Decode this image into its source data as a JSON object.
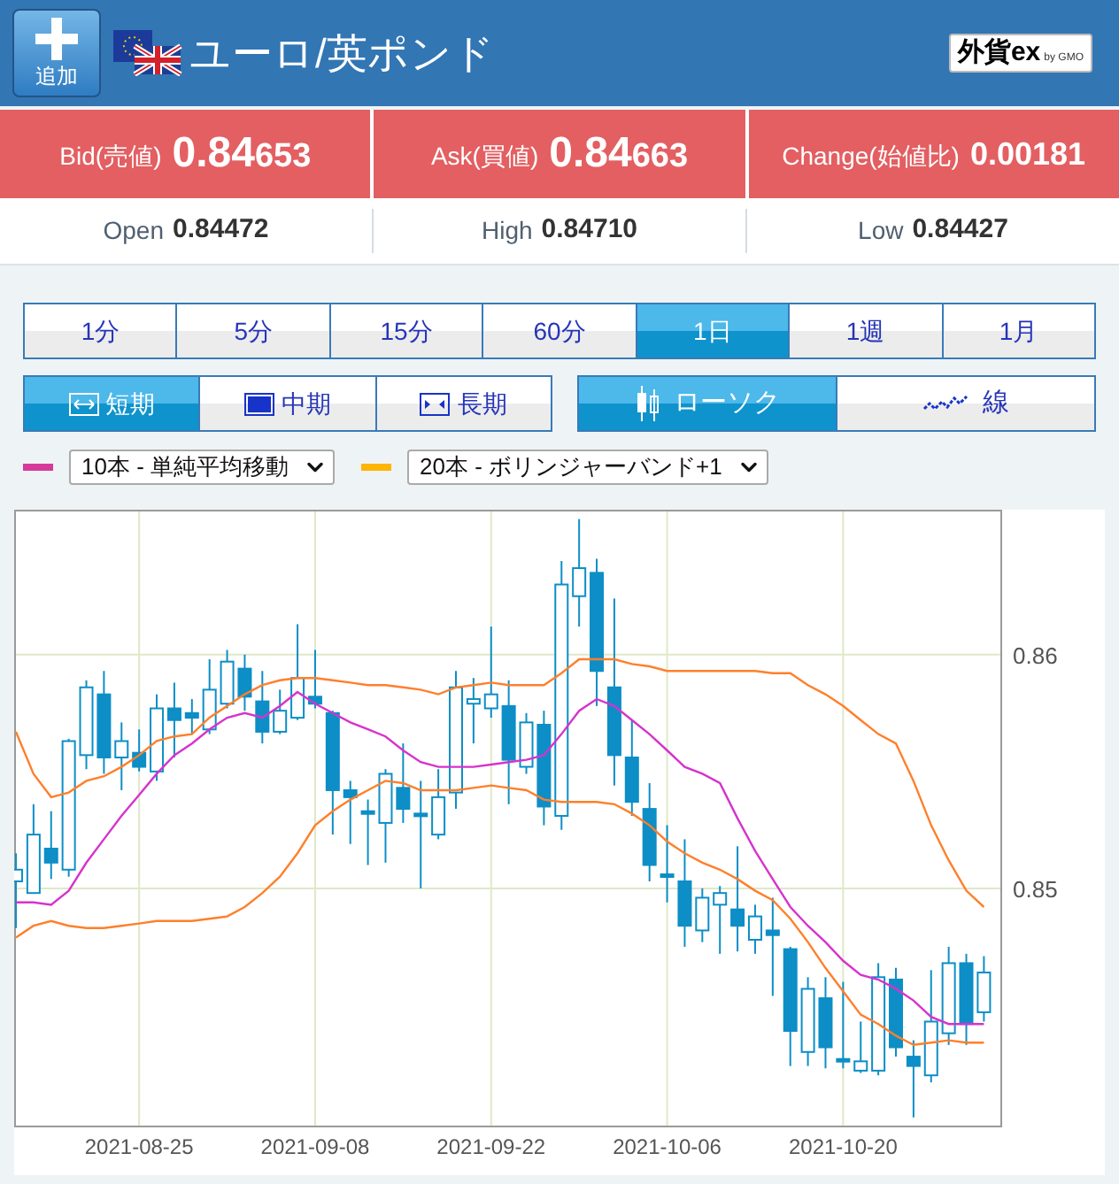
{
  "header": {
    "add_button": "追加",
    "pair": "ユーロ/英ポンド",
    "logo": {
      "mark": "外貨ex",
      "by": "by GMO"
    }
  },
  "quotes": [
    {
      "kind": "split",
      "label": "Bid(売値)",
      "major": "0.84",
      "minor": "653"
    },
    {
      "kind": "split",
      "label": "Ask(買値)",
      "major": "0.84",
      "minor": "663"
    },
    {
      "kind": "plain",
      "label": "Change(始値比)",
      "value": "0.00181"
    }
  ],
  "stats": [
    {
      "label": "Open",
      "value": "0.84472"
    },
    {
      "label": "High",
      "value": "0.84710"
    },
    {
      "label": "Low",
      "value": "0.84427"
    }
  ],
  "timeframes": [
    {
      "label": "1分",
      "selected": false
    },
    {
      "label": "5分",
      "selected": false
    },
    {
      "label": "15分",
      "selected": false
    },
    {
      "label": "60分",
      "selected": false
    },
    {
      "label": "1日",
      "selected": true
    },
    {
      "label": "1週",
      "selected": false
    },
    {
      "label": "1月",
      "selected": false
    }
  ],
  "periods": [
    {
      "label": "短期",
      "selected": true
    },
    {
      "label": "中期",
      "selected": false
    },
    {
      "label": "長期",
      "selected": false
    }
  ],
  "chart_types": [
    {
      "label": "ローソク",
      "selected": true
    },
    {
      "label": "線",
      "selected": false
    }
  ],
  "indicators": [
    {
      "color": "#d6399a",
      "value": "10本 - 単純平均移動"
    },
    {
      "color": "#ffb400",
      "value": "20本 - ボリンジャーバンド+1"
    }
  ],
  "chart_data": {
    "type": "candlestick",
    "grid": true,
    "categories": [
      null,
      null,
      null,
      null,
      null,
      null,
      null,
      "2021-08-25",
      null,
      null,
      null,
      null,
      null,
      null,
      null,
      null,
      null,
      "2021-09-08",
      null,
      null,
      null,
      null,
      null,
      null,
      null,
      null,
      null,
      "2021-09-22",
      null,
      null,
      null,
      null,
      null,
      null,
      null,
      null,
      null,
      "2021-10-06",
      null,
      null,
      null,
      null,
      null,
      null,
      null,
      null,
      null,
      "2021-10-20",
      null,
      null,
      null,
      null,
      null,
      null,
      null,
      null
    ],
    "ylim": [
      0.83985,
      0.8662
    ],
    "yticks": [
      {
        "value": 0.85,
        "label": "0.85"
      },
      {
        "value": 0.86,
        "label": "0.86"
      }
    ],
    "series": [
      {
        "type": "line",
        "color": "#d633cc",
        "values": [
          0.8494,
          0.8494,
          0.8493,
          0.8499,
          0.8511,
          0.8521,
          0.8531,
          0.854,
          0.8549,
          0.8557,
          0.8562,
          0.8568,
          0.8573,
          0.8575,
          0.8573,
          0.8578,
          0.8584,
          0.8579,
          0.8575,
          0.8571,
          0.8568,
          0.8565,
          0.8559,
          0.8554,
          0.8552,
          0.8552,
          0.8552,
          0.8553,
          0.8554,
          0.8555,
          0.8557,
          0.8566,
          0.8576,
          0.8581,
          0.8578,
          0.8572,
          0.8566,
          0.8559,
          0.8552,
          0.8549,
          0.8545,
          0.853,
          0.8516,
          0.8504,
          0.8492,
          0.8484,
          0.8477,
          0.8469,
          0.8463,
          0.8461,
          0.8457,
          0.8452,
          0.8445,
          0.8442,
          0.8442,
          0.8442
        ]
      },
      {
        "type": "line",
        "color": "#ff7f2a",
        "values": [
          0.8567,
          0.8549,
          0.8539,
          0.8541,
          0.8546,
          0.8548,
          0.8552,
          0.8557,
          0.8563,
          0.8565,
          0.8566,
          0.8573,
          0.8578,
          0.8583,
          0.8587,
          0.8589,
          0.859,
          0.859,
          0.8589,
          0.8588,
          0.8587,
          0.8587,
          0.8586,
          0.8585,
          0.8583,
          0.8586,
          0.8587,
          0.8588,
          0.8587,
          0.8587,
          0.8587,
          0.8592,
          0.8598,
          0.8598,
          0.8598,
          0.8596,
          0.8595,
          0.8593,
          0.8593,
          0.8593,
          0.8593,
          0.8593,
          0.8593,
          0.8592,
          0.8592,
          0.8587,
          0.8583,
          0.8578,
          0.8572,
          0.8566,
          0.8562,
          0.8546,
          0.8527,
          0.8512,
          0.8499,
          0.8492
        ]
      },
      {
        "type": "line",
        "color": "#ff7f2a",
        "values": [
          0.8479,
          0.8484,
          0.8486,
          0.8484,
          0.8483,
          0.8483,
          0.8484,
          0.8485,
          0.8486,
          0.8486,
          0.8486,
          0.8487,
          0.8488,
          0.8492,
          0.8498,
          0.8505,
          0.8515,
          0.8527,
          0.8533,
          0.8538,
          0.8542,
          0.8546,
          0.8545,
          0.8542,
          0.8542,
          0.8542,
          0.8543,
          0.8544,
          0.8543,
          0.8542,
          0.8538,
          0.8537,
          0.8537,
          0.8537,
          0.8536,
          0.8532,
          0.8527,
          0.852,
          0.8515,
          0.8511,
          0.8508,
          0.8504,
          0.8499,
          0.8495,
          0.8487,
          0.8477,
          0.8466,
          0.8456,
          0.8446,
          0.8442,
          0.8437,
          0.8433,
          0.8434,
          0.8435,
          0.8434,
          0.8434
        ]
      }
    ],
    "ohlc": [
      [
        0.8503,
        0.8515,
        0.8483,
        0.8508
      ],
      [
        0.8498,
        0.8536,
        0.8498,
        0.8523
      ],
      [
        0.8517,
        0.8533,
        0.8504,
        0.8511
      ],
      [
        0.8508,
        0.8564,
        0.8505,
        0.8563
      ],
      [
        0.8557,
        0.8589,
        0.8551,
        0.8586
      ],
      [
        0.8583,
        0.8593,
        0.8549,
        0.8556
      ],
      [
        0.8556,
        0.8571,
        0.8542,
        0.8563
      ],
      [
        0.8558,
        0.8568,
        0.855,
        0.8552
      ],
      [
        0.855,
        0.8583,
        0.8546,
        0.8577
      ],
      [
        0.8577,
        0.8588,
        0.8556,
        0.8572
      ],
      [
        0.8575,
        0.8581,
        0.8566,
        0.8573
      ],
      [
        0.8568,
        0.8598,
        0.8566,
        0.8585
      ],
      [
        0.8579,
        0.8602,
        0.8577,
        0.8597
      ],
      [
        0.8594,
        0.86,
        0.8576,
        0.8582
      ],
      [
        0.858,
        0.8593,
        0.8562,
        0.8567
      ],
      [
        0.8567,
        0.8585,
        0.8566,
        0.8576
      ],
      [
        0.8573,
        0.8613,
        0.8572,
        0.859
      ],
      [
        0.8582,
        0.8602,
        0.8577,
        0.8579
      ],
      [
        0.8575,
        0.8576,
        0.8523,
        0.8542
      ],
      [
        0.8542,
        0.8546,
        0.8519,
        0.8539
      ],
      [
        0.8533,
        0.8538,
        0.851,
        0.8532
      ],
      [
        0.8528,
        0.8551,
        0.8511,
        0.8549
      ],
      [
        0.8543,
        0.8562,
        0.8528,
        0.8534
      ],
      [
        0.8532,
        0.8546,
        0.85,
        0.8531
      ],
      [
        0.8523,
        0.8551,
        0.8521,
        0.8539
      ],
      [
        0.8541,
        0.8593,
        0.8534,
        0.8586
      ],
      [
        0.8579,
        0.859,
        0.8562,
        0.8581
      ],
      [
        0.8577,
        0.8612,
        0.8573,
        0.8583
      ],
      [
        0.8578,
        0.8589,
        0.8536,
        0.8555
      ],
      [
        0.8552,
        0.8575,
        0.8549,
        0.8571
      ],
      [
        0.857,
        0.8576,
        0.8527,
        0.8535
      ],
      [
        0.8531,
        0.864,
        0.8525,
        0.863
      ],
      [
        0.8625,
        0.8658,
        0.8612,
        0.8637
      ],
      [
        0.8635,
        0.8641,
        0.8578,
        0.8593
      ],
      [
        0.8586,
        0.8624,
        0.8544,
        0.8557
      ],
      [
        0.8556,
        0.8572,
        0.8531,
        0.8537
      ],
      [
        0.8534,
        0.8545,
        0.8503,
        0.851
      ],
      [
        0.8506,
        0.8527,
        0.8494,
        0.8505
      ],
      [
        0.8503,
        0.8521,
        0.8475,
        0.8484
      ],
      [
        0.8482,
        0.85,
        0.8477,
        0.8496
      ],
      [
        0.8493,
        0.8501,
        0.8472,
        0.8498
      ],
      [
        0.8491,
        0.8518,
        0.8473,
        0.8484
      ],
      [
        0.8478,
        0.8493,
        0.8472,
        0.8488
      ],
      [
        0.8482,
        0.8496,
        0.8454,
        0.848
      ],
      [
        0.8474,
        0.8475,
        0.8424,
        0.8439
      ],
      [
        0.843,
        0.8462,
        0.8424,
        0.8457
      ],
      [
        0.8453,
        0.8462,
        0.8423,
        0.8432
      ],
      [
        0.8427,
        0.846,
        0.8423,
        0.8426
      ],
      [
        0.8422,
        0.8443,
        0.8421,
        0.8426
      ],
      [
        0.8422,
        0.8468,
        0.842,
        0.8462
      ],
      [
        0.8461,
        0.8466,
        0.8428,
        0.8432
      ],
      [
        0.8428,
        0.8435,
        0.8402,
        0.8424
      ],
      [
        0.842,
        0.8465,
        0.8417,
        0.8443
      ],
      [
        0.8438,
        0.8475,
        0.8433,
        0.8468
      ],
      [
        0.8468,
        0.8472,
        0.8433,
        0.8442
      ],
      [
        0.8447,
        0.8471,
        0.8443,
        0.8464
      ]
    ]
  }
}
